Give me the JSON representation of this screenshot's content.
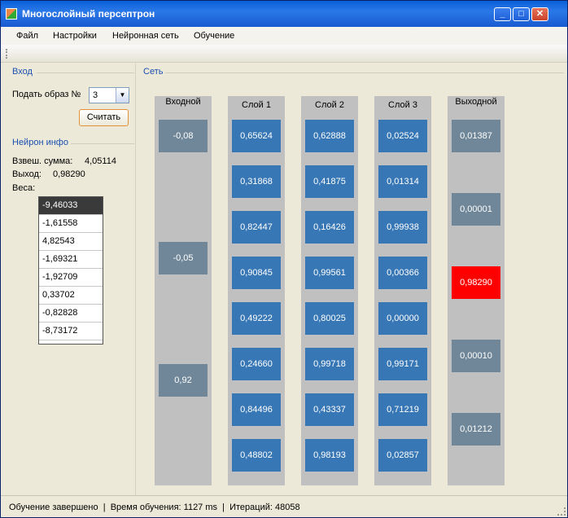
{
  "window": {
    "title": "Многослойный персептрон",
    "minimize": "_",
    "maximize": "□",
    "close": "✕"
  },
  "menu": [
    "Файл",
    "Настройки",
    "Нейронная сеть",
    "Обучение"
  ],
  "input_group": {
    "title": "Вход",
    "label": "Подать образ №",
    "selected": "3",
    "read_button": "Считать"
  },
  "neuron_info": {
    "title": "Нейрон инфо",
    "sum_label": "Взвеш. сумма:",
    "sum_value": "4,05114",
    "out_label": "Выход:",
    "out_value": "0,98290",
    "weights_label": "Веса:",
    "weights": [
      "-9,46033",
      "-1,61558",
      "4,82543",
      "-1,69321",
      "-1,92709",
      "0,33702",
      "-0,82828",
      "-8,73172"
    ]
  },
  "network": {
    "title": "Сеть",
    "columns": [
      {
        "header": "Входной",
        "values": [
          "-0,08",
          "-0,05",
          "0,92"
        ]
      },
      {
        "header": "Слой 1",
        "values": [
          "0,65624",
          "0,31868",
          "0,82447",
          "0,90845",
          "0,49222",
          "0,24660",
          "0,84496",
          "0,48802"
        ]
      },
      {
        "header": "Слой 2",
        "values": [
          "0,62888",
          "0,41875",
          "0,16426",
          "0,99561",
          "0,80025",
          "0,99718",
          "0,43337",
          "0,98193"
        ]
      },
      {
        "header": "Слой 3",
        "values": [
          "0,02524",
          "0,01314",
          "0,99938",
          "0,00366",
          "0,00000",
          "0,99171",
          "0,71219",
          "0,02857"
        ]
      },
      {
        "header": "Выходной",
        "values": [
          "0,01387",
          "0,00001",
          "0,98290",
          "0,00010",
          "0,01212"
        ]
      }
    ],
    "colors": {
      "gray": "#6f8799",
      "blue": "#3877b6",
      "highlight": "#ff0000"
    }
  },
  "status": {
    "text": "Обучение завершено  |  Время обучения: 1127 ms  |  Итераций: 48058"
  }
}
